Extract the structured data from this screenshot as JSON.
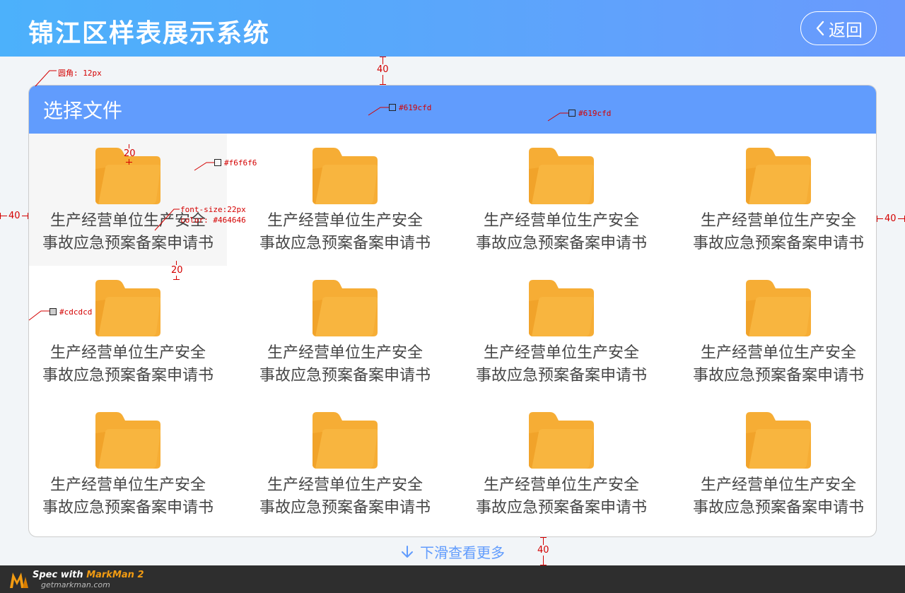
{
  "header": {
    "title": "锦江区样表展示系统",
    "back_label": "返回"
  },
  "panel": {
    "title": "选择文件"
  },
  "files": [
    {
      "name_line1": "生产经营单位生产安全",
      "name_line2": "事故应急预案备案申请书"
    },
    {
      "name_line1": "生产经营单位生产安全",
      "name_line2": "事故应急预案备案申请书"
    },
    {
      "name_line1": "生产经营单位生产安全",
      "name_line2": "事故应急预案备案申请书"
    },
    {
      "name_line1": "生产经营单位生产安全",
      "name_line2": "事故应急预案备案申请书"
    },
    {
      "name_line1": "生产经营单位生产安全",
      "name_line2": "事故应急预案备案申请书"
    },
    {
      "name_line1": "生产经营单位生产安全",
      "name_line2": "事故应急预案备案申请书"
    },
    {
      "name_line1": "生产经营单位生产安全",
      "name_line2": "事故应急预案备案申请书"
    },
    {
      "name_line1": "生产经营单位生产安全",
      "name_line2": "事故应急预案备案申请书"
    },
    {
      "name_line1": "生产经营单位生产安全",
      "name_line2": "事故应急预案备案申请书"
    },
    {
      "name_line1": "生产经营单位生产安全",
      "name_line2": "事故应急预案备案申请书"
    },
    {
      "name_line1": "生产经营单位生产安全",
      "name_line2": "事故应急预案备案申请书"
    },
    {
      "name_line1": "生产经营单位生产安全",
      "name_line2": "事故应急预案备案申请书"
    }
  ],
  "more_label": "下滑查看更多",
  "annotations": {
    "radius": "圆角: 12px",
    "header_color_1": "#619cfd",
    "header_color_2": "#619cfd",
    "selected_bg": "#f6f6f6",
    "border_color": "#cdcdcd",
    "font_line1": "font-size:22px",
    "font_line2": "color: #464646",
    "gap_top": "40",
    "gap_left": "40",
    "gap_right": "40",
    "gap_bottom": "40",
    "pad_top": "20",
    "pad_bottom": "20"
  },
  "footer": {
    "spec_prefix": "Spec with ",
    "brand": "MarkMan 2",
    "site": "getmarkman.com"
  },
  "colors": {
    "header_gradient_start": "#4cb1fb",
    "header_gradient_end": "#6a9afd",
    "panel_header": "#619cfd",
    "folder": "#f6ad35",
    "text": "#464646",
    "selected_bg": "#f6f6f6",
    "border": "#cdcdcd"
  }
}
